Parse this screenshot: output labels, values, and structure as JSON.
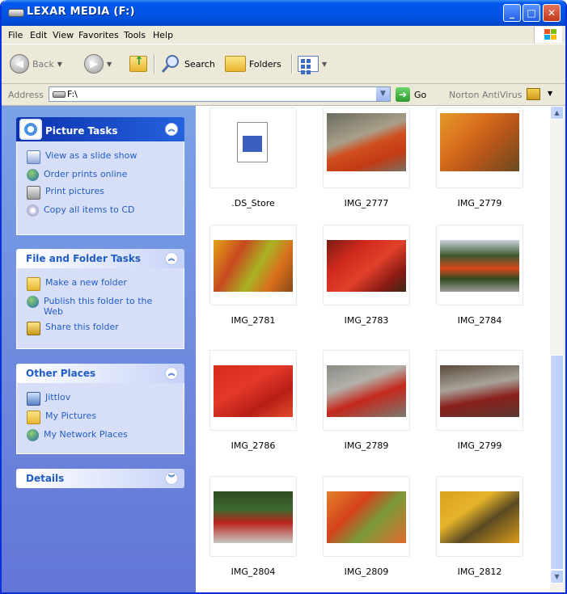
{
  "window": {
    "title": "LEXAR MEDIA (F:)",
    "min": "_",
    "max": "□",
    "close": "✕"
  },
  "menu": [
    "File",
    "Edit",
    "View",
    "Favorites",
    "Tools",
    "Help"
  ],
  "toolbar": {
    "back": "Back",
    "search": "Search",
    "folders": "Folders"
  },
  "address": {
    "label": "Address",
    "value": "F:\\",
    "go": "Go",
    "norton": "Norton AntiVirus"
  },
  "panels": {
    "picture_tasks": {
      "title": "Picture Tasks",
      "items": [
        "View as a slide show",
        "Order prints online",
        "Print pictures",
        "Copy all items to CD"
      ]
    },
    "file_tasks": {
      "title": "File and Folder Tasks",
      "items": [
        "Make a new folder",
        "Publish this folder to the Web",
        "Share this folder"
      ]
    },
    "other_places": {
      "title": "Other Places",
      "items": [
        "Jittlov",
        "My Pictures",
        "My Network Places"
      ]
    },
    "details": {
      "title": "Details"
    }
  },
  "files": [
    ".DS_Store",
    "IMG_2777",
    "IMG_2779",
    "IMG_2781",
    "IMG_2783",
    "IMG_2784",
    "IMG_2786",
    "IMG_2789",
    "IMG_2799",
    "IMG_2804",
    "IMG_2809",
    "IMG_2812"
  ],
  "colors": {
    "title_bar": "#0054e3",
    "task_pane": "#6b8fe0",
    "link": "#215dc6"
  }
}
